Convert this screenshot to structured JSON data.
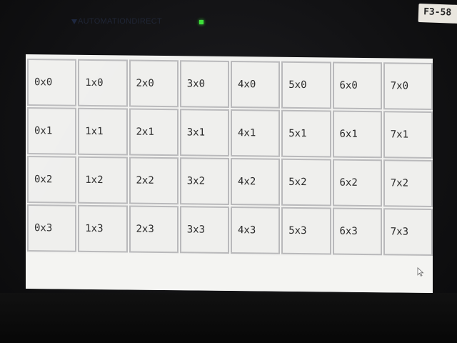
{
  "device": {
    "brand_text": "AUTOMATIONDIRECT",
    "sticker_label": "F3-58",
    "led_color": "#3ee03a"
  },
  "screen": {
    "background_color": "#f2f2f0",
    "grid": {
      "columns": 8,
      "rows": 4,
      "cells": [
        [
          "0x0",
          "1x0",
          "2x0",
          "3x0",
          "4x0",
          "5x0",
          "6x0",
          "7x0"
        ],
        [
          "0x1",
          "1x1",
          "2x1",
          "3x1",
          "4x1",
          "5x1",
          "6x1",
          "7x1"
        ],
        [
          "0x2",
          "1x2",
          "2x2",
          "3x2",
          "4x2",
          "5x2",
          "6x2",
          "7x2"
        ],
        [
          "0x3",
          "1x3",
          "2x3",
          "3x3",
          "4x3",
          "5x3",
          "6x3",
          "7x3"
        ]
      ]
    },
    "cursor_icon": "mouse-pointer-icon"
  }
}
